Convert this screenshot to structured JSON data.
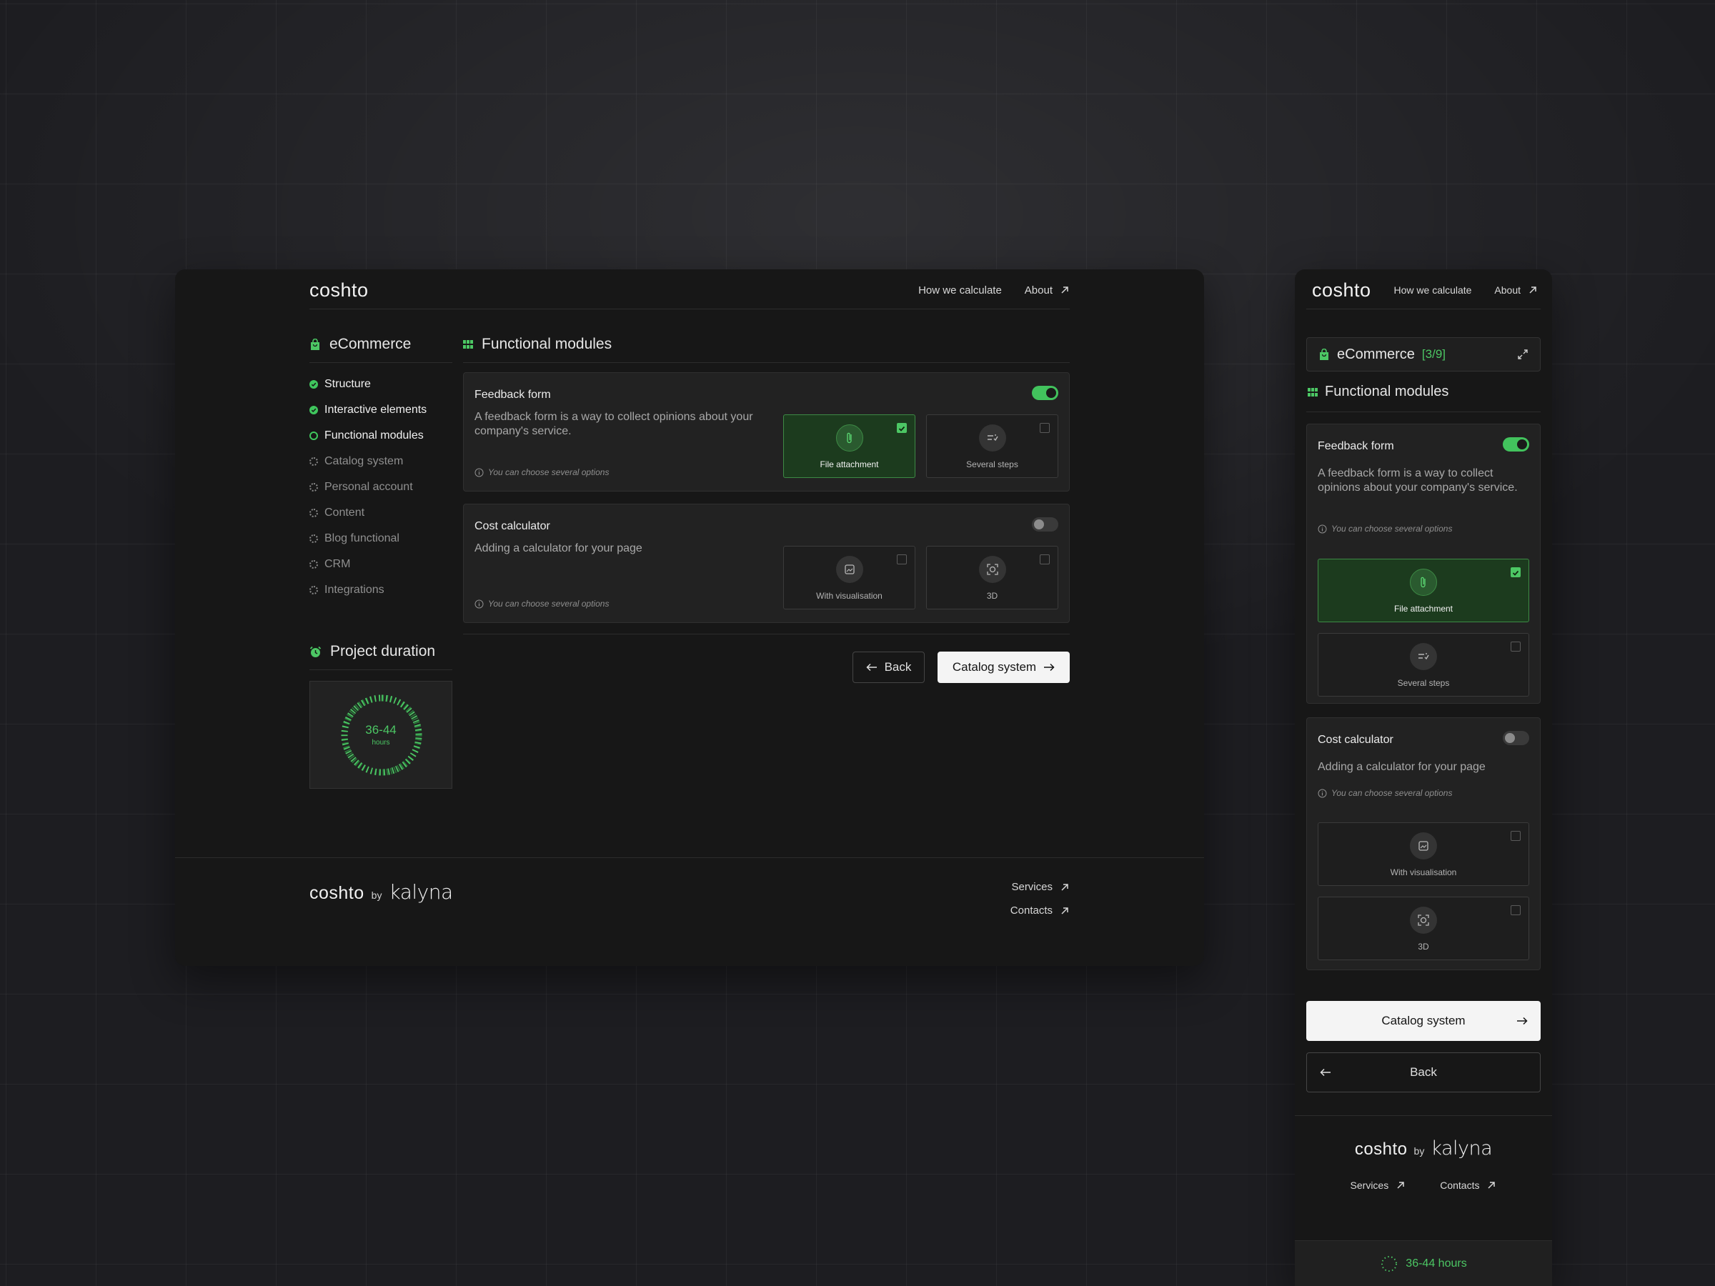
{
  "brand": {
    "logo": "coshto",
    "by": "by",
    "partner": "kalyna"
  },
  "nav": {
    "how": "How we calculate",
    "about": "About"
  },
  "sidebar": {
    "title": "eCommerce",
    "mobile_counter": "[3/9]",
    "steps": [
      {
        "label": "Structure",
        "state": "done"
      },
      {
        "label": "Interactive elements",
        "state": "done"
      },
      {
        "label": "Functional modules",
        "state": "current"
      },
      {
        "label": "Catalog system",
        "state": "todo"
      },
      {
        "label": "Personal account",
        "state": "todo"
      },
      {
        "label": "Content",
        "state": "todo"
      },
      {
        "label": "Blog functional",
        "state": "todo"
      },
      {
        "label": "CRM",
        "state": "todo"
      },
      {
        "label": "Integrations",
        "state": "todo"
      }
    ]
  },
  "duration": {
    "title": "Project duration",
    "value": "36-44",
    "unit": "hours",
    "mobile_bar": "36-44 hours"
  },
  "main": {
    "title": "Functional modules",
    "modules": [
      {
        "title": "Feedback form",
        "enabled": true,
        "desc": "A feedback form is a way to collect opinions about your company's service.",
        "hint": "You can choose several options",
        "options": [
          {
            "label": "File attachment",
            "selected": true,
            "icon": "paperclip-icon"
          },
          {
            "label": "Several steps",
            "selected": false,
            "icon": "steps-icon"
          }
        ]
      },
      {
        "title": "Cost calculator",
        "enabled": false,
        "desc": "Adding a calculator for your page",
        "hint": "You can choose several options",
        "options": [
          {
            "label": "With visualisation",
            "selected": false,
            "icon": "image-icon"
          },
          {
            "label": "3D",
            "selected": false,
            "icon": "3d-view-icon"
          }
        ]
      }
    ]
  },
  "buttons": {
    "back": "Back",
    "next": "Catalog system"
  },
  "footer": {
    "services": "Services",
    "contacts": "Contacts"
  },
  "colors": {
    "accent": "#4cc764",
    "background": "#171717",
    "card": "#222222"
  }
}
